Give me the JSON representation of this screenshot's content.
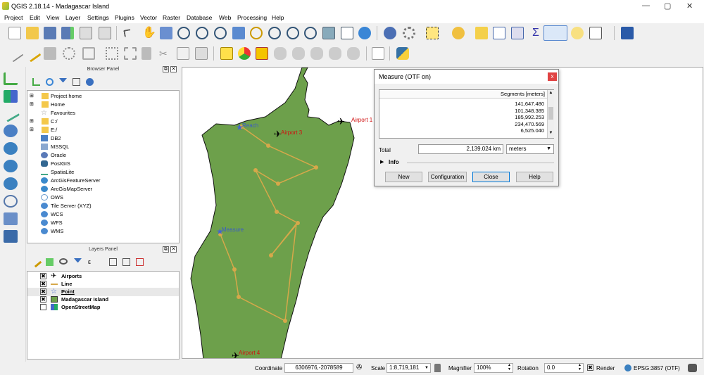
{
  "window": {
    "title": "QGIS 2.18.14 - Madagascar Island"
  },
  "menu": [
    "Project",
    "Edit",
    "View",
    "Layer",
    "Settings",
    "Plugins",
    "Vector",
    "Raster",
    "Database",
    "Web",
    "Processing",
    "Help"
  ],
  "browser": {
    "title": "Browser Panel",
    "items": [
      "Project home",
      "Home",
      "Favourites",
      "C:/",
      "E:/",
      "DB2",
      "MSSQL",
      "Oracle",
      "PostGIS",
      "SpatiaLite",
      "ArcGisFeatureServer",
      "ArcGisMapServer",
      "OWS",
      "Tile Server (XYZ)",
      "WCS",
      "WFS",
      "WMS"
    ]
  },
  "layers": {
    "title": "Layers Panel",
    "items": [
      "Airports",
      "Line",
      "Point",
      "Madagascar Island",
      "OpenStreetMap"
    ]
  },
  "map": {
    "labels": [
      "Airport 1",
      "Airport 3",
      "Airport 4",
      "Reach",
      "Measure"
    ]
  },
  "measure": {
    "title": "Measure (OTF on)",
    "column": "Segments [meters]",
    "segments": [
      "141,647.480",
      "101,348.385",
      "185,992.253",
      "234,470.569",
      "6,525.040"
    ],
    "total_label": "Total",
    "total_value": "2,139.024 km",
    "unit": "meters",
    "info": "Info",
    "buttons": [
      "New",
      "Configuration",
      "Close",
      "Help"
    ]
  },
  "status": {
    "coord_label": "Coordinate",
    "coord": "6306976,-2078589",
    "scale_label": "Scale",
    "scale": "1:8,719,181",
    "magnifier_label": "Magnifier",
    "magnifier": "100%",
    "rotation_label": "Rotation",
    "rotation": "0.0",
    "render": "Render",
    "crs": "EPSG:3857 (OTF)"
  }
}
